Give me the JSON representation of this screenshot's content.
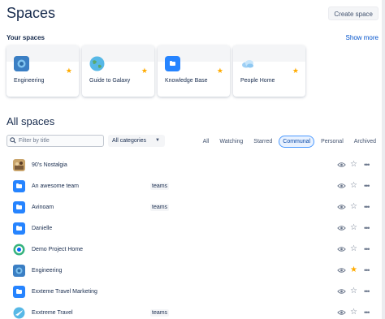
{
  "header": {
    "title": "Spaces",
    "create_label": "Create space"
  },
  "your_spaces": {
    "label": "Your spaces",
    "show_more": "Show more",
    "cards": [
      {
        "name": "Engineering",
        "icon": "engineering-avatar-icon",
        "starred": true
      },
      {
        "name": "Guide to Galaxy",
        "icon": "globe-icon",
        "starred": true
      },
      {
        "name": "Knowledge Base",
        "icon": "folder-icon",
        "starred": true
      },
      {
        "name": "People Home",
        "icon": "cloud-icon",
        "starred": true
      }
    ]
  },
  "all_spaces": {
    "title": "All spaces",
    "filter_placeholder": "Filter by title",
    "category_select": "All categories",
    "tabs": [
      "All",
      "Watching",
      "Starred",
      "Communal",
      "Personal",
      "Archived"
    ],
    "active_tab": "Communal",
    "rows": [
      {
        "name": "90's Nostalgia",
        "tag": "",
        "icon": "nostalgia-avatar-icon",
        "starred": false
      },
      {
        "name": "An awesome team",
        "tag": "teams",
        "icon": "folder-icon",
        "starred": false
      },
      {
        "name": "Avinoam",
        "tag": "teams",
        "icon": "folder-icon",
        "starred": false
      },
      {
        "name": "Danielle",
        "tag": "",
        "icon": "folder-icon",
        "starred": false
      },
      {
        "name": "Demo Project Home",
        "tag": "",
        "icon": "demo-avatar-icon",
        "starred": false
      },
      {
        "name": "Engineering",
        "tag": "",
        "icon": "engineering-avatar-icon",
        "starred": true
      },
      {
        "name": "Exxteme Travel Marketing",
        "tag": "",
        "icon": "folder-icon",
        "starred": false
      },
      {
        "name": "Exxtreme Travel",
        "tag": "teams",
        "icon": "travel-avatar-icon",
        "starred": false
      }
    ]
  },
  "colors": {
    "accent": "#0052cc",
    "star": "#ffab00",
    "folder": "#2684ff"
  }
}
